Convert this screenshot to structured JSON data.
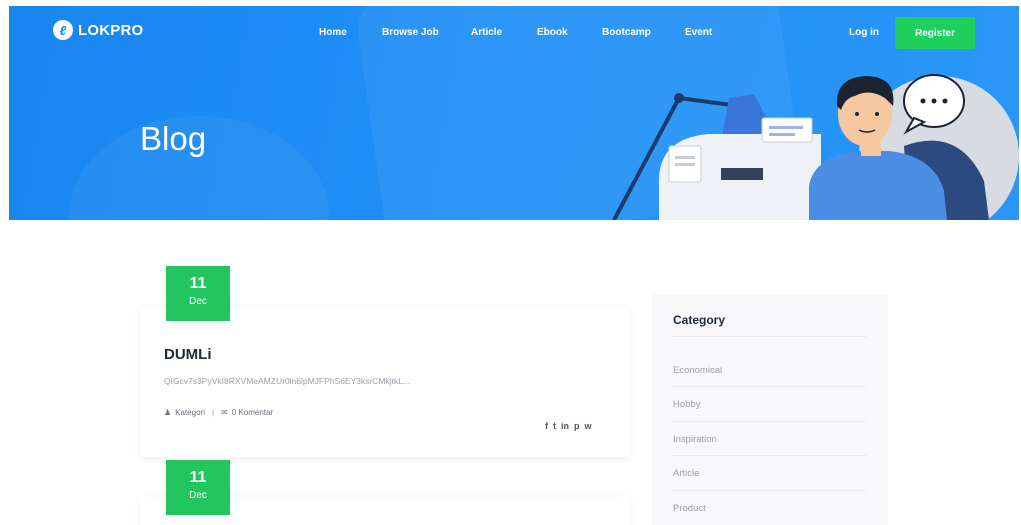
{
  "brand": {
    "name": "LOKPRO"
  },
  "nav": {
    "items": [
      "Home",
      "Browse Job",
      "Article",
      "Ebook",
      "Bootcamp",
      "Event"
    ],
    "login": "Log in",
    "register": "Register"
  },
  "hero": {
    "title": "Blog"
  },
  "posts": [
    {
      "day": "11",
      "month": "Dec",
      "title": "DUMLi",
      "excerpt": "QIGcv7s3PyVkI8RXVMeAMZUr0ln6lpMJFPhS6EY3ksrCMkjtkL...",
      "category_label": "Kategori",
      "comments_label": "0 Komentar",
      "share_icons": [
        "f",
        "t",
        "in",
        "p",
        "w"
      ]
    },
    {
      "day": "11",
      "month": "Dec"
    }
  ],
  "sidebar": {
    "title": "Category",
    "categories": [
      "Economical",
      "Hobby",
      "Inspiration",
      "Article",
      "Product"
    ]
  },
  "colors": {
    "hero_blue": "#1a86f0",
    "accent_green": "#22c55e",
    "register_green": "#1fcf5e"
  }
}
